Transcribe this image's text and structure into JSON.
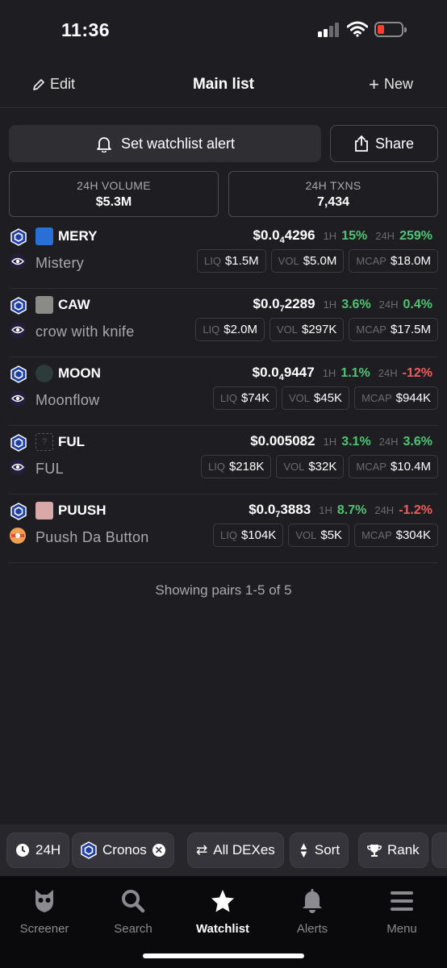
{
  "status_bar": {
    "time": "11:36"
  },
  "header": {
    "edit_label": "Edit",
    "title": "Main list",
    "new_label": "New"
  },
  "actions": {
    "alert_label": "Set watchlist alert",
    "share_label": "Share"
  },
  "stats": {
    "volume": {
      "label": "24H VOLUME",
      "value": "$5.3M"
    },
    "txns": {
      "label": "24H TXNS",
      "value": "7,434"
    }
  },
  "pair_labels": {
    "h1": "1H",
    "h24": "24H",
    "liq": "LIQ",
    "vol": "VOL",
    "mcap": "MCAP"
  },
  "pairs": [
    {
      "symbol": "MERY",
      "name": "Mistery",
      "price_prefix": "$0.0",
      "price_zeros": "4",
      "price_digits": "4296",
      "change_1h": "15%",
      "change_24h": "259%",
      "liq": "$1.5M",
      "vol": "$5.0M",
      "mcap": "$18.0M"
    },
    {
      "symbol": "CAW",
      "name": "crow with knife",
      "price_prefix": "$0.0",
      "price_zeros": "7",
      "price_digits": "2289",
      "change_1h": "3.6%",
      "change_24h": "0.4%",
      "liq": "$2.0M",
      "vol": "$297K",
      "mcap": "$17.5M"
    },
    {
      "symbol": "MOON",
      "name": "Moonflow",
      "price_prefix": "$0.0",
      "price_zeros": "4",
      "price_digits": "9447",
      "change_1h": "1.1%",
      "change_24h": "-12%",
      "liq": "$74K",
      "vol": "$45K",
      "mcap": "$944K"
    },
    {
      "symbol": "FUL",
      "name": "FUL",
      "price_prefix": "$0.005082",
      "price_zeros": "",
      "price_digits": "",
      "change_1h": "3.1%",
      "change_24h": "3.6%",
      "liq": "$218K",
      "vol": "$32K",
      "mcap": "$10.4M"
    },
    {
      "symbol": "PUUSH",
      "name": "Puush Da Button",
      "price_prefix": "$0.0",
      "price_zeros": "7",
      "price_digits": "3883",
      "change_1h": "8.7%",
      "change_24h": "-1.2%",
      "liq": "$104K",
      "vol": "$5K",
      "mcap": "$304K"
    }
  ],
  "footer_text": "Showing pairs 1-5 of 5",
  "filters": {
    "time": "24H",
    "chain": "Cronos",
    "dex": "All DEXes",
    "sort": "Sort",
    "rank": "Rank"
  },
  "tabs": {
    "screener": "Screener",
    "search": "Search",
    "watchlist": "Watchlist",
    "alerts": "Alerts",
    "menu": "Menu"
  },
  "colors": {
    "positive": "#4fc472",
    "negative": "#f25b5b",
    "background": "#1e1e22"
  }
}
